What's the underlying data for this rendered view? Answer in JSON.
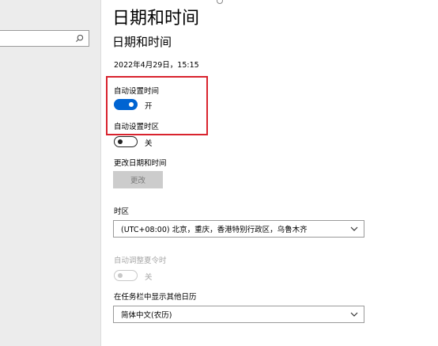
{
  "header": {
    "title": "日期和时间"
  },
  "section": {
    "title": "日期和时间"
  },
  "current_datetime": "2022年4月29日，15:15",
  "auto_time": {
    "label": "自动设置时间",
    "state": "开"
  },
  "auto_timezone": {
    "label": "自动设置时区",
    "state": "关"
  },
  "change_datetime": {
    "label": "更改日期和时间",
    "button": "更改"
  },
  "timezone": {
    "label": "时区",
    "value": "(UTC+08:00) 北京，重庆，香港特别行政区，乌鲁木齐"
  },
  "dst": {
    "label": "自动调整夏令时",
    "state": "关"
  },
  "calendar": {
    "label": "在任务栏中显示其他日历",
    "value": "简体中文(农历)"
  },
  "colors": {
    "accent": "#0064d2",
    "highlight": "#d9232e",
    "sidebar": "#ececec"
  },
  "icons": {
    "search": "search-icon",
    "chevron": "chevron-down-icon"
  }
}
